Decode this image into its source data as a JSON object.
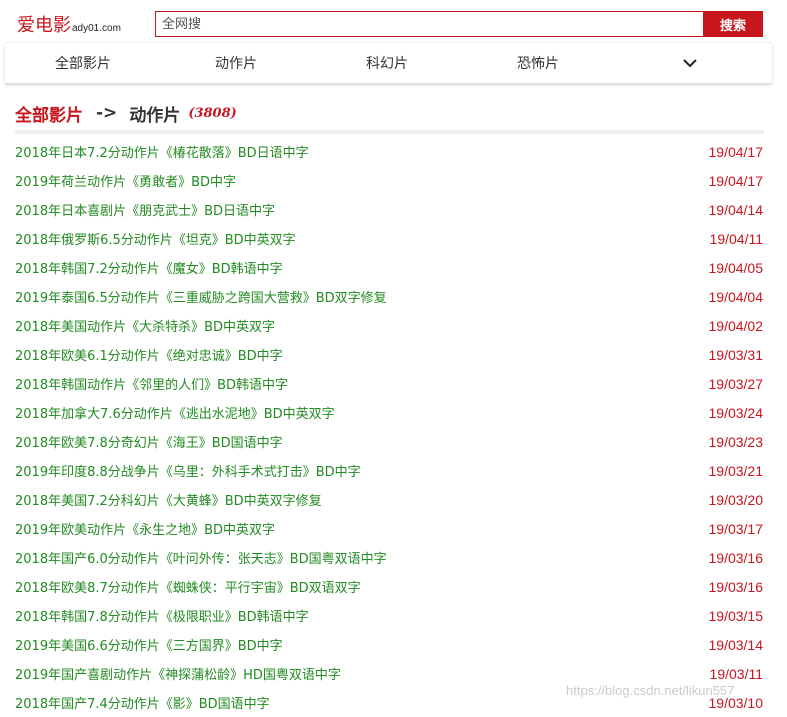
{
  "site": {
    "logo_cn": "爱电影",
    "logo_en": "ady01.com"
  },
  "search": {
    "placeholder": "全网搜",
    "button": "搜索"
  },
  "nav": {
    "items": [
      "全部影片",
      "动作片",
      "科幻片",
      "恐怖片"
    ],
    "more_icon": "chevron-down-icon"
  },
  "breadcrumb": {
    "home": "全部影片",
    "separator": "->",
    "current": "动作片",
    "count": "(3808)"
  },
  "movies": [
    {
      "title": "2018年日本7.2分动作片《椿花散落》BD日语中字",
      "date": "19/04/17"
    },
    {
      "title": "2019年荷兰动作片《勇敢者》BD中字",
      "date": "19/04/17"
    },
    {
      "title": "2018年日本喜剧片《朋克武士》BD日语中字",
      "date": "19/04/14"
    },
    {
      "title": "2018年俄罗斯6.5分动作片《坦克》BD中英双字",
      "date": "19/04/11"
    },
    {
      "title": "2018年韩国7.2分动作片《魔女》BD韩语中字",
      "date": "19/04/05"
    },
    {
      "title": "2019年泰国6.5分动作片《三重威胁之跨国大营救》BD双字修复",
      "date": "19/04/04"
    },
    {
      "title": "2018年美国动作片《大杀特杀》BD中英双字",
      "date": "19/04/02"
    },
    {
      "title": "2018年欧美6.1分动作片《绝对忠诚》BD中字",
      "date": "19/03/31"
    },
    {
      "title": "2018年韩国动作片《邻里的人们》BD韩语中字",
      "date": "19/03/27"
    },
    {
      "title": "2018年加拿大7.6分动作片《逃出水泥地》BD中英双字",
      "date": "19/03/24"
    },
    {
      "title": "2018年欧美7.8分奇幻片《海王》BD国语中字",
      "date": "19/03/23"
    },
    {
      "title": "2019年印度8.8分战争片《乌里：外科手术式打击》BD中字",
      "date": "19/03/21"
    },
    {
      "title": "2018年美国7.2分科幻片《大黄蜂》BD中英双字修复",
      "date": "19/03/20"
    },
    {
      "title": "2019年欧美动作片《永生之地》BD中英双字",
      "date": "19/03/17"
    },
    {
      "title": "2018年国产6.0分动作片《叶问外传：张天志》BD国粤双语中字",
      "date": "19/03/16"
    },
    {
      "title": "2018年欧美8.7分动作片《蜘蛛侠：平行宇宙》BD双语双字",
      "date": "19/03/16"
    },
    {
      "title": "2018年韩国7.8分动作片《极限职业》BD韩语中字",
      "date": "19/03/15"
    },
    {
      "title": "2019年美国6.6分动作片《三方国界》BD中字",
      "date": "19/03/14"
    },
    {
      "title": "2019年国产喜剧动作片《神探蒲松龄》HD国粤双语中字",
      "date": "19/03/11"
    },
    {
      "title": "2018年国产7.4分动作片《影》BD国语中字",
      "date": "19/03/10"
    }
  ],
  "watermark": "https://blog.csdn.net/likun557",
  "colors": {
    "brand_red": "#c8161d",
    "title_green": "#228b22"
  }
}
